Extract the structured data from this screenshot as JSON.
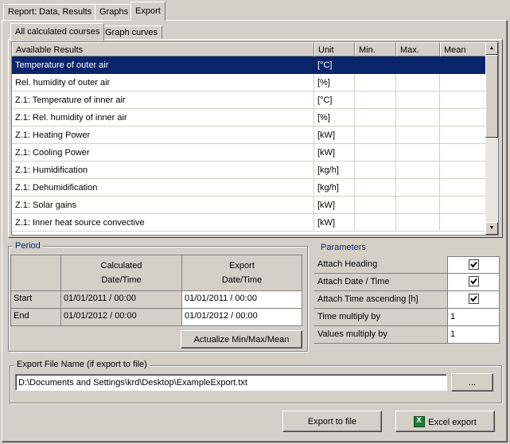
{
  "tabs": [
    {
      "label": "Report: Data, Results"
    },
    {
      "label": "Graphs"
    },
    {
      "label": "Export"
    }
  ],
  "subtabs": [
    {
      "label": "All calculated courses"
    },
    {
      "label": "Graph curves"
    }
  ],
  "results_table": {
    "columns": [
      "Available Results",
      "Unit",
      "Min.",
      "Max.",
      "Mean"
    ],
    "rows": [
      {
        "name": "Temperature of outer air",
        "unit": "[°C]"
      },
      {
        "name": "Rel. humidity of outer air",
        "unit": "[%]"
      },
      {
        "name": "Z.1: Temperature of inner air",
        "unit": "[°C]"
      },
      {
        "name": "Z.1: Rel. humidity of inner air",
        "unit": "[%]"
      },
      {
        "name": "Z.1: Heating Power",
        "unit": "[kW]"
      },
      {
        "name": "Z.1: Cooling Power",
        "unit": "[kW]"
      },
      {
        "name": "Z.1: Humidification",
        "unit": "[kg/h]"
      },
      {
        "name": "Z.1: Dehumidification",
        "unit": "[kg/h]"
      },
      {
        "name": "Z.1: Solar gains",
        "unit": "[kW]"
      },
      {
        "name": "Z.1: Inner heat source convective",
        "unit": "[kW]"
      }
    ]
  },
  "period": {
    "title": "Period",
    "col_calculated_line1": "Calculated",
    "col_calculated_line2": "Date/Time",
    "col_export_line1": "Export",
    "col_export_line2": "Date/Time",
    "start_label": "Start",
    "end_label": "End",
    "start_calculated": "01/01/2011 / 00:00",
    "end_calculated": "01/01/2012 / 00:00",
    "start_export": "01/01/2011 / 00:00",
    "end_export": "01/01/2012 / 00:00",
    "actualize_label": "Actualize Min/Max/Mean"
  },
  "parameters": {
    "title": "Parameters",
    "attach_heading_label": "Attach Heading",
    "attach_datetime_label": "Attach Date / Time",
    "attach_time_asc_label": "Attach Time ascending [h]",
    "time_multiply_label": "Time multiply by",
    "time_multiply_value": "1",
    "values_multiply_label": "Values multiply by",
    "values_multiply_value": "1"
  },
  "export_file": {
    "title": "Export File Name (if export to file)",
    "path": "D:\\Documents and Settings\\krd\\Desktop\\ExampleExport.txt",
    "browse_label": "..."
  },
  "buttons": {
    "export_to_file": "Export to file",
    "excel_export": "Excel export"
  },
  "colors": {
    "face": "#d4d0c8",
    "selection": "#0a246a"
  }
}
